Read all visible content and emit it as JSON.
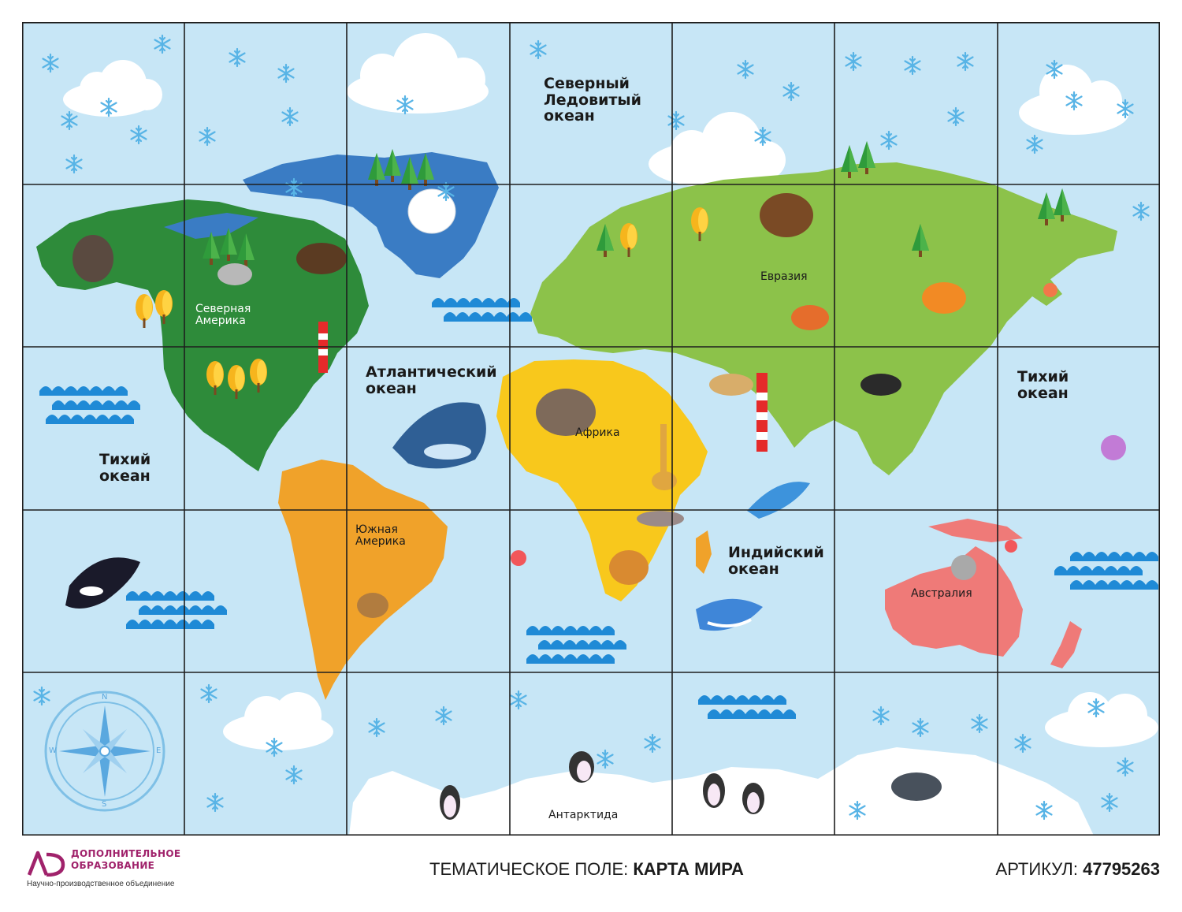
{
  "map": {
    "oceans": {
      "arctic": "Северный\nЛедовитый\nокеан",
      "atlantic": "Атлантический\nокеан",
      "pacific_left": "Тихий\nокеан",
      "pacific_right": "Тихий\nокеан",
      "indian": "Индийский\nокеан"
    },
    "continents": {
      "north_america": "Северная\nАмерика",
      "south_america": "Южная\nАмерика",
      "eurasia": "Евразия",
      "africa": "Африка",
      "australia": "Австралия",
      "antarctica": "Антарктида"
    },
    "compass": {
      "n": "N",
      "s": "S",
      "e": "E",
      "w": "W"
    },
    "colors": {
      "ocean": "#c7e6f6",
      "grid": "#1e1e1e",
      "north_america": "#2e8b3a",
      "greenland": "#3a7cc4",
      "south_america": "#f0a22a",
      "africa": "#f8c81c",
      "eurasia": "#8cc24a",
      "australia": "#ef7a78",
      "waves": "#1f8ad6",
      "snow": "#ffffff"
    }
  },
  "footer": {
    "brand": "ДОПОЛНИТЕЛЬНОЕ\nОБРАЗОВАНИЕ",
    "tagline": "Научно-производственное объединение",
    "center_prefix": "ТЕМАТИЧЕСКОЕ ПОЛЕ: ",
    "center_title": "КАРТА МИРА",
    "article_prefix": "АРТИКУЛ: ",
    "article_number": "47795263"
  }
}
